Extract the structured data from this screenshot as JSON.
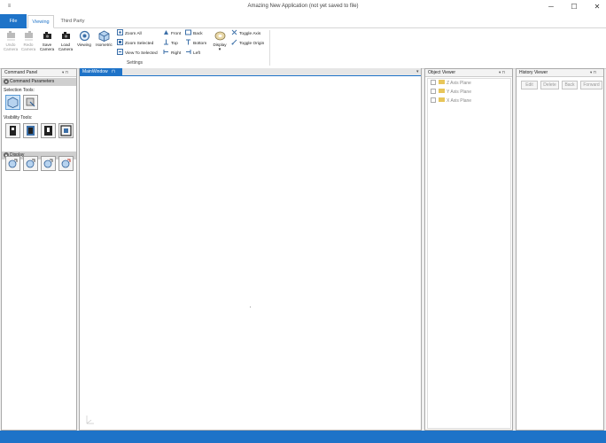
{
  "window": {
    "title": "Amazing New Application  (not yet saved to file)",
    "minimize": "─",
    "maximize": "☐",
    "close": "✕",
    "app_icon": "≡"
  },
  "tabs": [
    {
      "label": "File"
    },
    {
      "label": "Viewing"
    },
    {
      "label": "Third Party"
    }
  ],
  "ribbon": {
    "camera": [
      {
        "label": "Undo\nCamera",
        "line1": "Undo",
        "line2": "Camera",
        "enabled": false,
        "icon": "undo-camera-icon"
      },
      {
        "label": "Redo Camera",
        "line1": "Redo",
        "line2": "Camera",
        "enabled": false,
        "icon": "redo-camera-icon"
      },
      {
        "label": "Save Camera",
        "line1": "Save",
        "line2": "Camera",
        "enabled": true,
        "icon": "save-camera-icon"
      },
      {
        "label": "Load Camera",
        "line1": "Load",
        "line2": "Camera",
        "enabled": true,
        "icon": "load-camera-icon"
      }
    ],
    "viewing_label": "Viewing",
    "isometric_label": "Isometric",
    "zoom_all": "Zoom All",
    "zoom_selected": "Zoom Selected",
    "view_to_selected": "View To Selected",
    "front": "Front",
    "top": "Top",
    "right": "Right",
    "back": "Back",
    "bottom": "Bottom",
    "left": "Left",
    "display": "Display",
    "toggle_axis": "Toggle Axis",
    "toggle_origin": "Toggle Origin",
    "group_label": "Settings"
  },
  "command_panel": {
    "title": "Command Panel",
    "section_params": "Command Parameters",
    "selection_tools": "Selection Tools:",
    "visibility_tools": "Visibility Tools:",
    "section_display": "Display"
  },
  "main_window": {
    "tab": "MainWindow",
    "pin": "⊓"
  },
  "object_viewer": {
    "title": "Object Viewer",
    "items": [
      {
        "label": "Z Axis Plane"
      },
      {
        "label": "Y Axis Plane"
      },
      {
        "label": "X Axis Plane"
      }
    ]
  },
  "history_viewer": {
    "title": "History Viewer",
    "buttons": [
      {
        "label": "Edit"
      },
      {
        "label": "Delete"
      },
      {
        "label": "Back"
      },
      {
        "label": "Forward"
      }
    ]
  },
  "panel_controls": "▾ ⊓",
  "colors": {
    "accent": "#1e73c8"
  }
}
